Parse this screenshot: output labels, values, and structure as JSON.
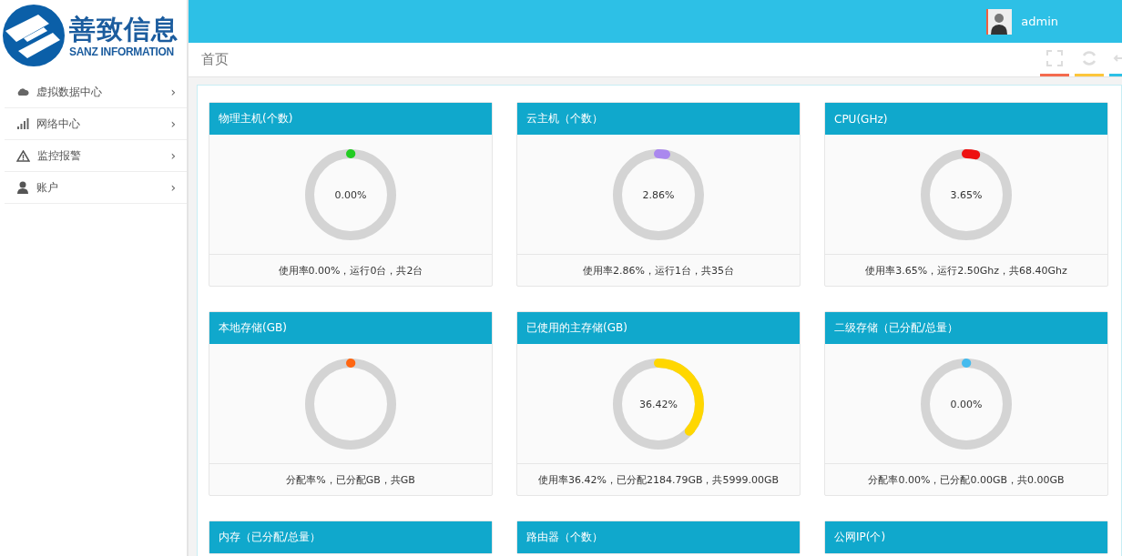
{
  "logo": {
    "title": "善致信息",
    "subtitle": "SANZ INFORMATION"
  },
  "header": {
    "user": "admin"
  },
  "sidebar": {
    "items": [
      {
        "label": "虚拟数据中心",
        "chevron": "›"
      },
      {
        "label": "网络中心",
        "chevron": "›"
      },
      {
        "label": "监控报警",
        "chevron": "›"
      },
      {
        "label": "账户",
        "chevron": "›"
      }
    ]
  },
  "breadcrumb": {
    "title": "首页"
  },
  "cards": [
    {
      "title": "物理主机(个数)",
      "level": 0,
      "color": "#22cc22",
      "value": "0.00%",
      "footer": "使用率0.00%，运行0台，共2台"
    },
    {
      "title": "云主机（个数）",
      "level": 0.0286,
      "color": "#aa88ee",
      "value": "2.86%",
      "footer": "使用率2.86%，运行1台，共35台"
    },
    {
      "title": "CPU(GHz)",
      "level": 0.0365,
      "color": "#ee1111",
      "value": "3.65%",
      "footer": "使用率3.65%，运行2.50Ghz，共68.40Ghz"
    },
    {
      "title": "本地存储(GB)",
      "level": 0,
      "color": "#ff6611",
      "footer": "分配率%，已分配GB，共GB"
    },
    {
      "title": "已使用的主存储(GB)",
      "level": 0.3642,
      "color": "#ffd700",
      "value": "36.42%",
      "footer": "使用率36.42%，已分配2184.79GB，共5999.00GB"
    },
    {
      "title": "二级存储（已分配/总量）",
      "level": 0,
      "color": "#44bbee",
      "value": "0.00%",
      "footer": "分配率0.00%，已分配0.00GB，共0.00GB"
    },
    {
      "title": "内存（已分配/总量）"
    },
    {
      "title": "路由器（个数）"
    },
    {
      "title": "公网IP(个)"
    }
  ]
}
